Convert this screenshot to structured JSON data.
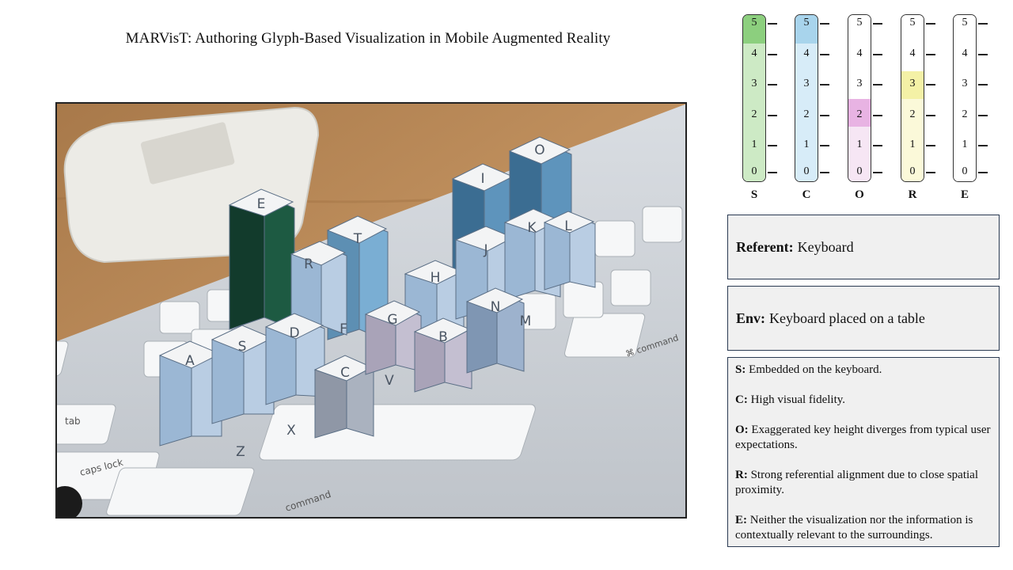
{
  "title": "MARVisT: Authoring Glyph-Based Visualization in Mobile Augmented Reality",
  "scales": [
    {
      "letter": "S",
      "level": 5,
      "color": "#8ccf7e",
      "light": "#cdeac5"
    },
    {
      "letter": "C",
      "level": 5,
      "color": "#a8d4ec",
      "light": "#d7ecf8"
    },
    {
      "letter": "O",
      "level": 2,
      "color": "#e8b3e3",
      "light": "#f6e6f4"
    },
    {
      "letter": "R",
      "level": 3,
      "color": "#f4f1a6",
      "light": "#fbf9d9"
    },
    {
      "letter": "E",
      "level": 0,
      "color": "#ffffff",
      "light": "#ffffff"
    }
  ],
  "scale_numbers": [
    "5",
    "4",
    "3",
    "2",
    "1",
    "0"
  ],
  "referent": {
    "label": "Referent:",
    "value": "Keyboard"
  },
  "env": {
    "label": "Env:",
    "value": "Keyboard placed on a table"
  },
  "notes": [
    {
      "key": "S:",
      "text": "Embedded on the keyboard."
    },
    {
      "key": "C:",
      "text": "High visual fidelity."
    },
    {
      "key": "O:",
      "text": "Exaggerated key height diverges from typical user expectations."
    },
    {
      "key": "R:",
      "text": "Strong referential alignment due to close spatial proximity."
    },
    {
      "key": "E:",
      "text": "Neither the visualization nor the information is contextually relevant to the surroundings."
    }
  ],
  "photo": {
    "keys": [
      "E",
      "R",
      "T",
      "I",
      "O",
      "J",
      "K",
      "L",
      "H",
      "G",
      "A",
      "S",
      "D",
      "F",
      "C",
      "V",
      "B",
      "N",
      "M",
      "Z",
      "X"
    ],
    "small_labels": [
      "tab",
      "caps lock",
      "command",
      "⌘ command"
    ]
  }
}
